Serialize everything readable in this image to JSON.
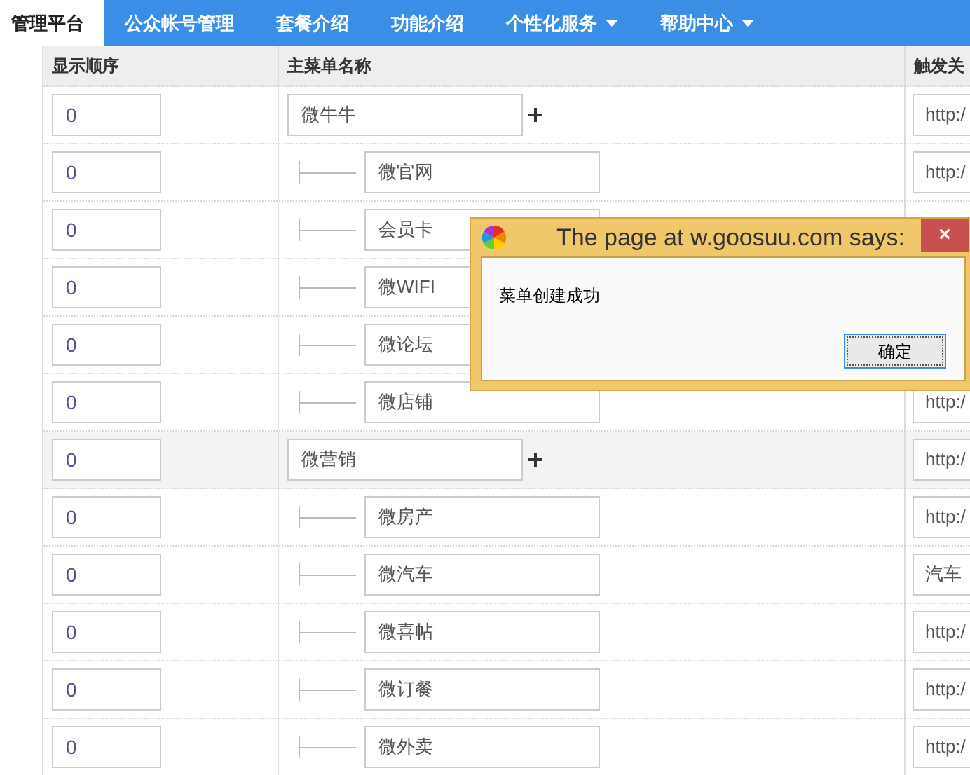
{
  "nav": [
    {
      "label": "管理平台",
      "selected": true,
      "dropdown": false
    },
    {
      "label": "公众帐号管理",
      "selected": false,
      "dropdown": false
    },
    {
      "label": "套餐介绍",
      "selected": false,
      "dropdown": false
    },
    {
      "label": "功能介绍",
      "selected": false,
      "dropdown": false
    },
    {
      "label": "个性化服务",
      "selected": false,
      "dropdown": true
    },
    {
      "label": "帮助中心",
      "selected": false,
      "dropdown": true
    }
  ],
  "table": {
    "columns": [
      "显示顺序",
      "主菜单名称",
      "触发关"
    ],
    "rows": [
      {
        "kind": "parent",
        "order": "0",
        "name": "微牛牛",
        "trigger": "http:/",
        "highlighted": false
      },
      {
        "kind": "child",
        "order": "0",
        "name": "微官网",
        "trigger": "http:/",
        "highlighted": false
      },
      {
        "kind": "child",
        "order": "0",
        "name": "会员卡",
        "highlighted": false
      },
      {
        "kind": "child",
        "order": "0",
        "name": "微WIFI",
        "highlighted": false
      },
      {
        "kind": "child",
        "order": "0",
        "name": "微论坛",
        "highlighted": false
      },
      {
        "kind": "child",
        "order": "0",
        "name": "微店铺",
        "trigger": "http:/",
        "highlighted": false
      },
      {
        "kind": "parent",
        "order": "0",
        "name": "微营销",
        "trigger": "http:/",
        "highlighted": true
      },
      {
        "kind": "child",
        "order": "0",
        "name": "微房产",
        "trigger": "http:/",
        "highlighted": false
      },
      {
        "kind": "child",
        "order": "0",
        "name": "微汽车",
        "trigger": "汽车",
        "highlighted": false
      },
      {
        "kind": "child",
        "order": "0",
        "name": "微喜帖",
        "trigger": "http:/",
        "highlighted": false
      },
      {
        "kind": "child",
        "order": "0",
        "name": "微订餐",
        "trigger": "http:/",
        "highlighted": false
      },
      {
        "kind": "child",
        "order": "0",
        "name": "微外卖",
        "trigger": "http:/",
        "highlighted": false
      }
    ]
  },
  "dialog": {
    "title": "The page at w.goosuu.com says:",
    "close": "×",
    "message": "菜单创建成功",
    "button": "确定"
  }
}
